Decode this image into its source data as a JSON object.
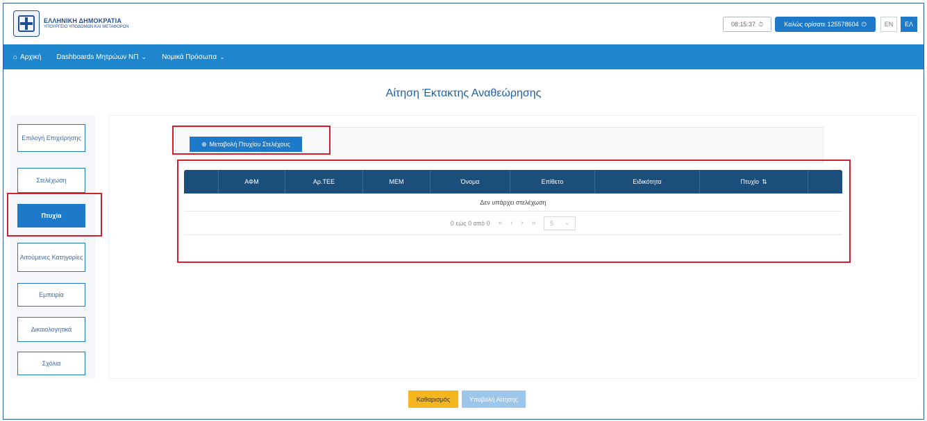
{
  "header": {
    "org_title": "ΕΛΛΗΝΙΚΗ ΔΗΜΟΚΡΑΤΙΑ",
    "org_subtitle": "ΥΠΟΥΡΓΕΙΟ ΥΠΟΔΟΜΩΝ ΚΑΙ ΜΕΤΑΦΟΡΩΝ",
    "clock": "08:15:37",
    "welcome": "Καλώς ορίσατε 125578604",
    "lang_en": "EN",
    "lang_el": "ΕΛ"
  },
  "nav": {
    "items": [
      {
        "label": "Αρχική",
        "icon": "home-icon"
      },
      {
        "label": "Dashboards Μητρώων ΝΠ",
        "icon": "chevron-down-icon"
      },
      {
        "label": "Νομικά Πρόσωπα",
        "icon": "chevron-down-icon"
      }
    ]
  },
  "page": {
    "title": "Αίτηση Έκτακτης Αναθεώρησης"
  },
  "sidebar": {
    "items": [
      {
        "label": "Επιλογή Επιχείρησης"
      },
      {
        "label": "Στελέχωση"
      },
      {
        "label": "Πτυχία",
        "active": true
      },
      {
        "label": "Αιτούμενες Κατηγορίες"
      },
      {
        "label": "Εμπειρία"
      },
      {
        "label": "Δικαιολογητικά"
      },
      {
        "label": "Σχόλια"
      }
    ]
  },
  "toolbar": {
    "add_label": "Μεταβολή Πτυχίου Στελέχους"
  },
  "table": {
    "columns": [
      "",
      "ΑΦΜ",
      "Αρ.ΤΕΕ",
      "ΜΕΜ",
      "Όνομα",
      "Επίθετο",
      "Ειδικότητα",
      "Πτυχίο",
      ""
    ],
    "empty_message": "Δεν υπάρχει στελέχωση",
    "pager_text": "0 εώς 0 από 0",
    "page_size": "5",
    "pager_controls": {
      "first": "«",
      "prev": "‹",
      "next": "›",
      "last": "»"
    }
  },
  "actions": {
    "clear_label": "Καθαρισμός",
    "submit_label": "Υποβολή Αίτησης"
  },
  "colors": {
    "primary": "#1e79c9",
    "nav": "#1e86cc",
    "table_header": "#1c4e7c",
    "warning": "#f5b51e",
    "highlight": "#d0202f"
  }
}
